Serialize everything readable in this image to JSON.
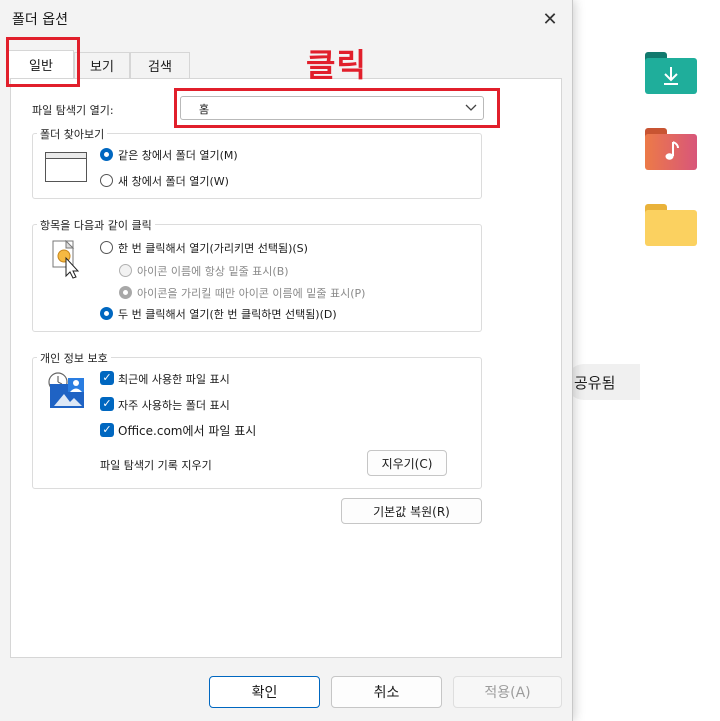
{
  "window": {
    "title": "폴더 옵션",
    "close_glyph": "✕"
  },
  "tabs": [
    {
      "label": "일반",
      "active": true
    },
    {
      "label": "보기",
      "active": false
    },
    {
      "label": "검색",
      "active": false
    }
  ],
  "annotation": {
    "text": "클릭",
    "color": "#e11f2b"
  },
  "general": {
    "open_explorer_label": "파일 탐색기 열기:",
    "open_explorer_value": "홈",
    "browse_group": {
      "title": "폴더 찾아보기",
      "options": [
        {
          "label": "같은 창에서 폴더 열기(M)",
          "checked": true
        },
        {
          "label": "새 창에서 폴더 열기(W)",
          "checked": false
        }
      ]
    },
    "click_group": {
      "title": "항목을 다음과 같이 클릭",
      "single_click": {
        "label": "한 번 클릭해서 열기(가리키면 선택됨)(S)",
        "checked": false
      },
      "sub_options": [
        {
          "label": "아이콘 이름에 항상 밑줄 표시(B)",
          "checked": false,
          "enabled": false
        },
        {
          "label": "아이콘을 가리킬 때만 아이콘 이름에 밑줄 표시(P)",
          "checked": true,
          "enabled": false
        }
      ],
      "double_click": {
        "label": "두 번 클릭해서 열기(한 번 클릭하면 선택됨)(D)",
        "checked": true
      }
    },
    "privacy_group": {
      "title": "개인 정보 보호",
      "checkboxes": [
        {
          "label": "최근에 사용한 파일 표시",
          "checked": true
        },
        {
          "label": "자주 사용하는 폴더 표시",
          "checked": true
        },
        {
          "label": "Office.com에서 파일 표시",
          "checked": true
        }
      ],
      "clear_label": "파일 탐색기 기록 지우기",
      "clear_button": "지우기(C)"
    },
    "restore_button": "기본값 복원(R)"
  },
  "footer": {
    "ok": "확인",
    "cancel": "취소",
    "apply": "적용(A)"
  },
  "background": {
    "shared_label": "공유됨",
    "folder_colors": {
      "downloads": "#1a9a8a",
      "music": "#e0683a",
      "plain": "#f7c948"
    }
  },
  "colors": {
    "accent": "#0067c0",
    "highlight_border": "#e11f2b"
  }
}
